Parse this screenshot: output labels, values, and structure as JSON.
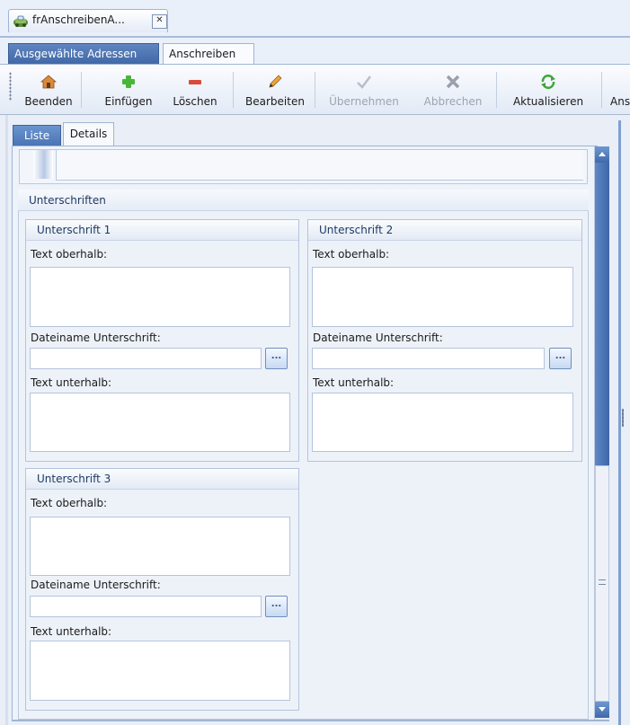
{
  "document_tab": {
    "title": "frAnschreibenA...",
    "close": "✕",
    "icon": "car-key-icon"
  },
  "ribbon_tabs": [
    {
      "label": "Ausgewählte Adressen",
      "active": true
    },
    {
      "label": "Anschreiben",
      "active": false
    }
  ],
  "toolbar": {
    "buttons": [
      {
        "label": "Beenden",
        "icon": "house-exit-icon",
        "enabled": true
      },
      {
        "label": "Einfügen",
        "icon": "plus-icon",
        "enabled": true
      },
      {
        "label": "Löschen",
        "icon": "minus-icon",
        "enabled": true
      },
      {
        "label": "Bearbeiten",
        "icon": "pencil-icon",
        "enabled": true
      },
      {
        "label": "Übernehmen",
        "icon": "checkmark-icon",
        "enabled": false
      },
      {
        "label": "Abbrechen",
        "icon": "x-icon",
        "enabled": false
      },
      {
        "label": "Aktualisieren",
        "icon": "refresh-icon",
        "enabled": true
      },
      {
        "label": "Ans",
        "icon": "",
        "enabled": true
      }
    ]
  },
  "sub_tabs": [
    {
      "label": "Liste",
      "active": false
    },
    {
      "label": "Details",
      "active": true
    }
  ],
  "section": {
    "title": "Unterschriften",
    "groups": [
      {
        "title": "Unterschrift 1",
        "above_label": "Text oberhalb:",
        "above_value": "",
        "file_label": "Dateiname Unterschrift:",
        "file_value": "",
        "browse": "...",
        "below_label": "Text unterhalb:",
        "below_value": ""
      },
      {
        "title": "Unterschrift 2",
        "above_label": "Text oberhalb:",
        "above_value": "",
        "file_label": "Dateiname Unterschrift:",
        "file_value": "",
        "browse": "...",
        "below_label": "Text unterhalb:",
        "below_value": ""
      },
      {
        "title": "Unterschrift 3",
        "above_label": "Text oberhalb:",
        "above_value": "",
        "file_label": "Dateiname Unterschrift:",
        "file_value": "",
        "browse": "...",
        "below_label": "Text unterhalb:",
        "below_value": ""
      }
    ]
  },
  "colors": {
    "accent": "#4a73b3",
    "background": "#e9eef7",
    "border": "#9fb5d4"
  }
}
